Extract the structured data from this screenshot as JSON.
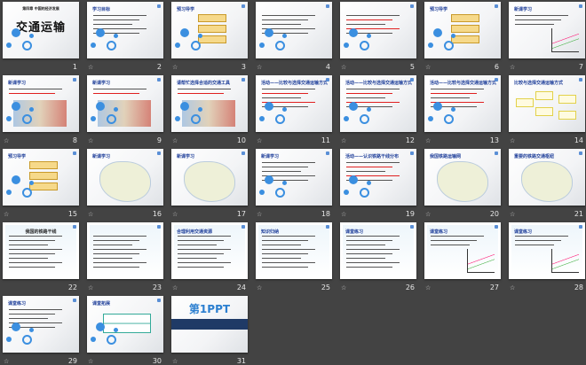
{
  "view": "slide-sorter",
  "colors": {
    "background": "#434343",
    "title": "#1f3f9a",
    "accent": "#3b8fe0"
  },
  "anim_icon": "☆",
  "slides": [
    {
      "number": "1",
      "title": "交通运输",
      "subtitle": "第四章 中国的经济发展",
      "style": "cover",
      "anim": false
    },
    {
      "number": "2",
      "title": "学习目标",
      "style": "text",
      "anim": true
    },
    {
      "number": "3",
      "title": "预习导学",
      "style": "buttons",
      "anim": true
    },
    {
      "number": "4",
      "title": "",
      "style": "text",
      "anim": true
    },
    {
      "number": "5",
      "title": "",
      "style": "text-red",
      "anim": true
    },
    {
      "number": "6",
      "title": "预习导学",
      "style": "buttons",
      "anim": true
    },
    {
      "number": "7",
      "title": "新课学习",
      "style": "chart",
      "anim": true
    },
    {
      "number": "8",
      "title": "新课学习",
      "style": "image",
      "anim": true
    },
    {
      "number": "9",
      "title": "新课学习",
      "style": "image",
      "anim": true
    },
    {
      "number": "10",
      "title": "请帮忙选择合适的交通工具",
      "style": "image",
      "anim": true
    },
    {
      "number": "11",
      "title": "活动——比较与选择交通运输方式",
      "style": "text-red",
      "anim": true
    },
    {
      "number": "12",
      "title": "活动——比较与选择交通运输方式",
      "style": "text-red",
      "anim": true
    },
    {
      "number": "13",
      "title": "活动——比较与选择交通运输方式",
      "style": "text-red",
      "anim": true
    },
    {
      "number": "14",
      "title": "比较与选择交通运输方式",
      "style": "diagram",
      "anim": true
    },
    {
      "number": "15",
      "title": "预习导学",
      "style": "buttons",
      "anim": true
    },
    {
      "number": "16",
      "title": "新课学习",
      "style": "map",
      "anim": true
    },
    {
      "number": "17",
      "title": "新课学习",
      "style": "map",
      "anim": true
    },
    {
      "number": "18",
      "title": "新课学习",
      "style": "text",
      "anim": true
    },
    {
      "number": "19",
      "title": "活动——认识铁路干线分布",
      "style": "text-red",
      "anim": true
    },
    {
      "number": "20",
      "title": "我国铁路运输网",
      "style": "map",
      "anim": true
    },
    {
      "number": "21",
      "title": "重要的铁路交通枢纽",
      "style": "map",
      "anim": true
    },
    {
      "number": "22",
      "title": "我国的铁路干线",
      "style": "framed-center",
      "anim": false
    },
    {
      "number": "23",
      "title": "",
      "style": "framed-text",
      "anim": true
    },
    {
      "number": "24",
      "title": "合理利用交通资源",
      "style": "framed-text",
      "anim": true
    },
    {
      "number": "25",
      "title": "知识归纳",
      "style": "framed-text",
      "anim": true
    },
    {
      "number": "26",
      "title": "课堂练习",
      "style": "framed-text",
      "anim": true
    },
    {
      "number": "27",
      "title": "课堂练习",
      "style": "framed-chart",
      "anim": true
    },
    {
      "number": "28",
      "title": "课堂练习",
      "style": "framed-chart",
      "anim": true
    },
    {
      "number": "29",
      "title": "课堂练习",
      "style": "text",
      "anim": true
    },
    {
      "number": "30",
      "title": "课堂拓展",
      "style": "table",
      "anim": true
    },
    {
      "number": "31",
      "title": "第1PPT",
      "style": "brand",
      "anim": true
    }
  ]
}
